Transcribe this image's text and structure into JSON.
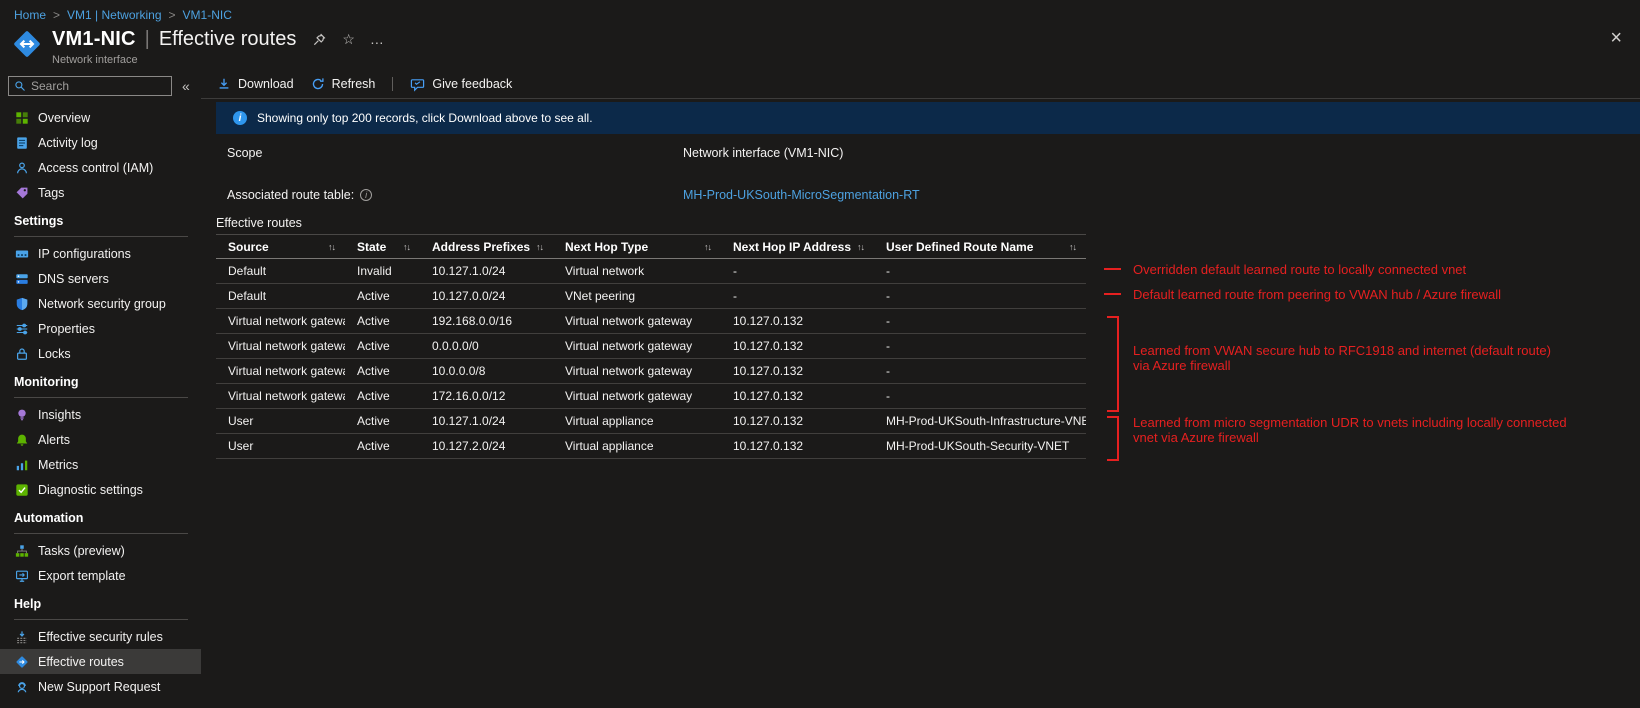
{
  "breadcrumb": {
    "items": [
      "Home",
      "VM1 | Networking",
      "VM1-NIC"
    ]
  },
  "header": {
    "title": "VM1-NIC",
    "page": "Effective routes",
    "resource_type": "Network interface"
  },
  "icons": {
    "breadcrumb_sep": ">",
    "collapse": "«",
    "close": "×",
    "star": "☆",
    "more": "…",
    "sort": "↑↓",
    "info": "i",
    "title_sep": "|"
  },
  "sidebar": {
    "search_placeholder": "Search",
    "general": [
      "Overview",
      "Activity log",
      "Access control (IAM)",
      "Tags"
    ],
    "sections": [
      {
        "header": "Settings",
        "items": [
          "IP configurations",
          "DNS servers",
          "Network security group",
          "Properties",
          "Locks"
        ]
      },
      {
        "header": "Monitoring",
        "items": [
          "Insights",
          "Alerts",
          "Metrics",
          "Diagnostic settings"
        ]
      },
      {
        "header": "Automation",
        "items": [
          "Tasks (preview)",
          "Export template"
        ]
      },
      {
        "header": "Help",
        "items": [
          "Effective security rules",
          "Effective routes",
          "New Support Request"
        ]
      }
    ],
    "active_item": "Effective routes"
  },
  "toolbar": {
    "download_label": "Download",
    "refresh_label": "Refresh",
    "feedback_label": "Give feedback"
  },
  "banner": {
    "text": "Showing only top 200 records, click Download above to see all."
  },
  "fields": {
    "scope_label": "Scope",
    "scope_value": "Network interface (VM1-NIC)",
    "route_table_label": "Associated route table:",
    "route_table_value": "MH-Prod-UKSouth-MicroSegmentation-RT",
    "section_title": "Effective routes"
  },
  "table": {
    "columns": [
      "Source",
      "State",
      "Address Prefixes",
      "Next Hop Type",
      "Next Hop IP Address",
      "User Defined Route Name"
    ],
    "rows": [
      {
        "source": "Default",
        "state": "Invalid",
        "prefix": "10.127.1.0/24",
        "next_hop_type": "Virtual network",
        "next_hop_ip": "-",
        "udr_name": "-"
      },
      {
        "source": "Default",
        "state": "Active",
        "prefix": "10.127.0.0/24",
        "next_hop_type": "VNet peering",
        "next_hop_ip": "-",
        "udr_name": "-"
      },
      {
        "source": "Virtual network gateway",
        "state": "Active",
        "prefix": "192.168.0.0/16",
        "next_hop_type": "Virtual network gateway",
        "next_hop_ip": "10.127.0.132",
        "udr_name": "-"
      },
      {
        "source": "Virtual network gateway",
        "state": "Active",
        "prefix": "0.0.0.0/0",
        "next_hop_type": "Virtual network gateway",
        "next_hop_ip": "10.127.0.132",
        "udr_name": "-"
      },
      {
        "source": "Virtual network gateway",
        "state": "Active",
        "prefix": "10.0.0.0/8",
        "next_hop_type": "Virtual network gateway",
        "next_hop_ip": "10.127.0.132",
        "udr_name": "-"
      },
      {
        "source": "Virtual network gateway",
        "state": "Active",
        "prefix": "172.16.0.0/12",
        "next_hop_type": "Virtual network gateway",
        "next_hop_ip": "10.127.0.132",
        "udr_name": "-"
      },
      {
        "source": "User",
        "state": "Active",
        "prefix": "10.127.1.0/24",
        "next_hop_type": "Virtual appliance",
        "next_hop_ip": "10.127.0.132",
        "udr_name": "MH-Prod-UKSouth-Infrastructure-VNET"
      },
      {
        "source": "User",
        "state": "Active",
        "prefix": "10.127.2.0/24",
        "next_hop_type": "Virtual appliance",
        "next_hop_ip": "10.127.0.132",
        "udr_name": "MH-Prod-UKSouth-Security-VNET"
      }
    ]
  },
  "annotations": {
    "color": "#e62020",
    "items": [
      {
        "text": "Overridden default learned route to locally connected vnet"
      },
      {
        "text": "Default learned route from peering to VWAN hub / Azure firewall"
      },
      {
        "text": "Learned from VWAN secure hub to RFC1918 and internet (default route) via Azure firewall"
      },
      {
        "text": "Learned from micro segmentation UDR to vnets including locally connected vnet via Azure firewall"
      }
    ]
  },
  "colors": {
    "link_blue": "#4da1e0",
    "toolbar_icon_blue": "#479ef5",
    "banner_bg": "#0c2949",
    "annotation_red": "#e62020",
    "background": "#1b1a19"
  }
}
